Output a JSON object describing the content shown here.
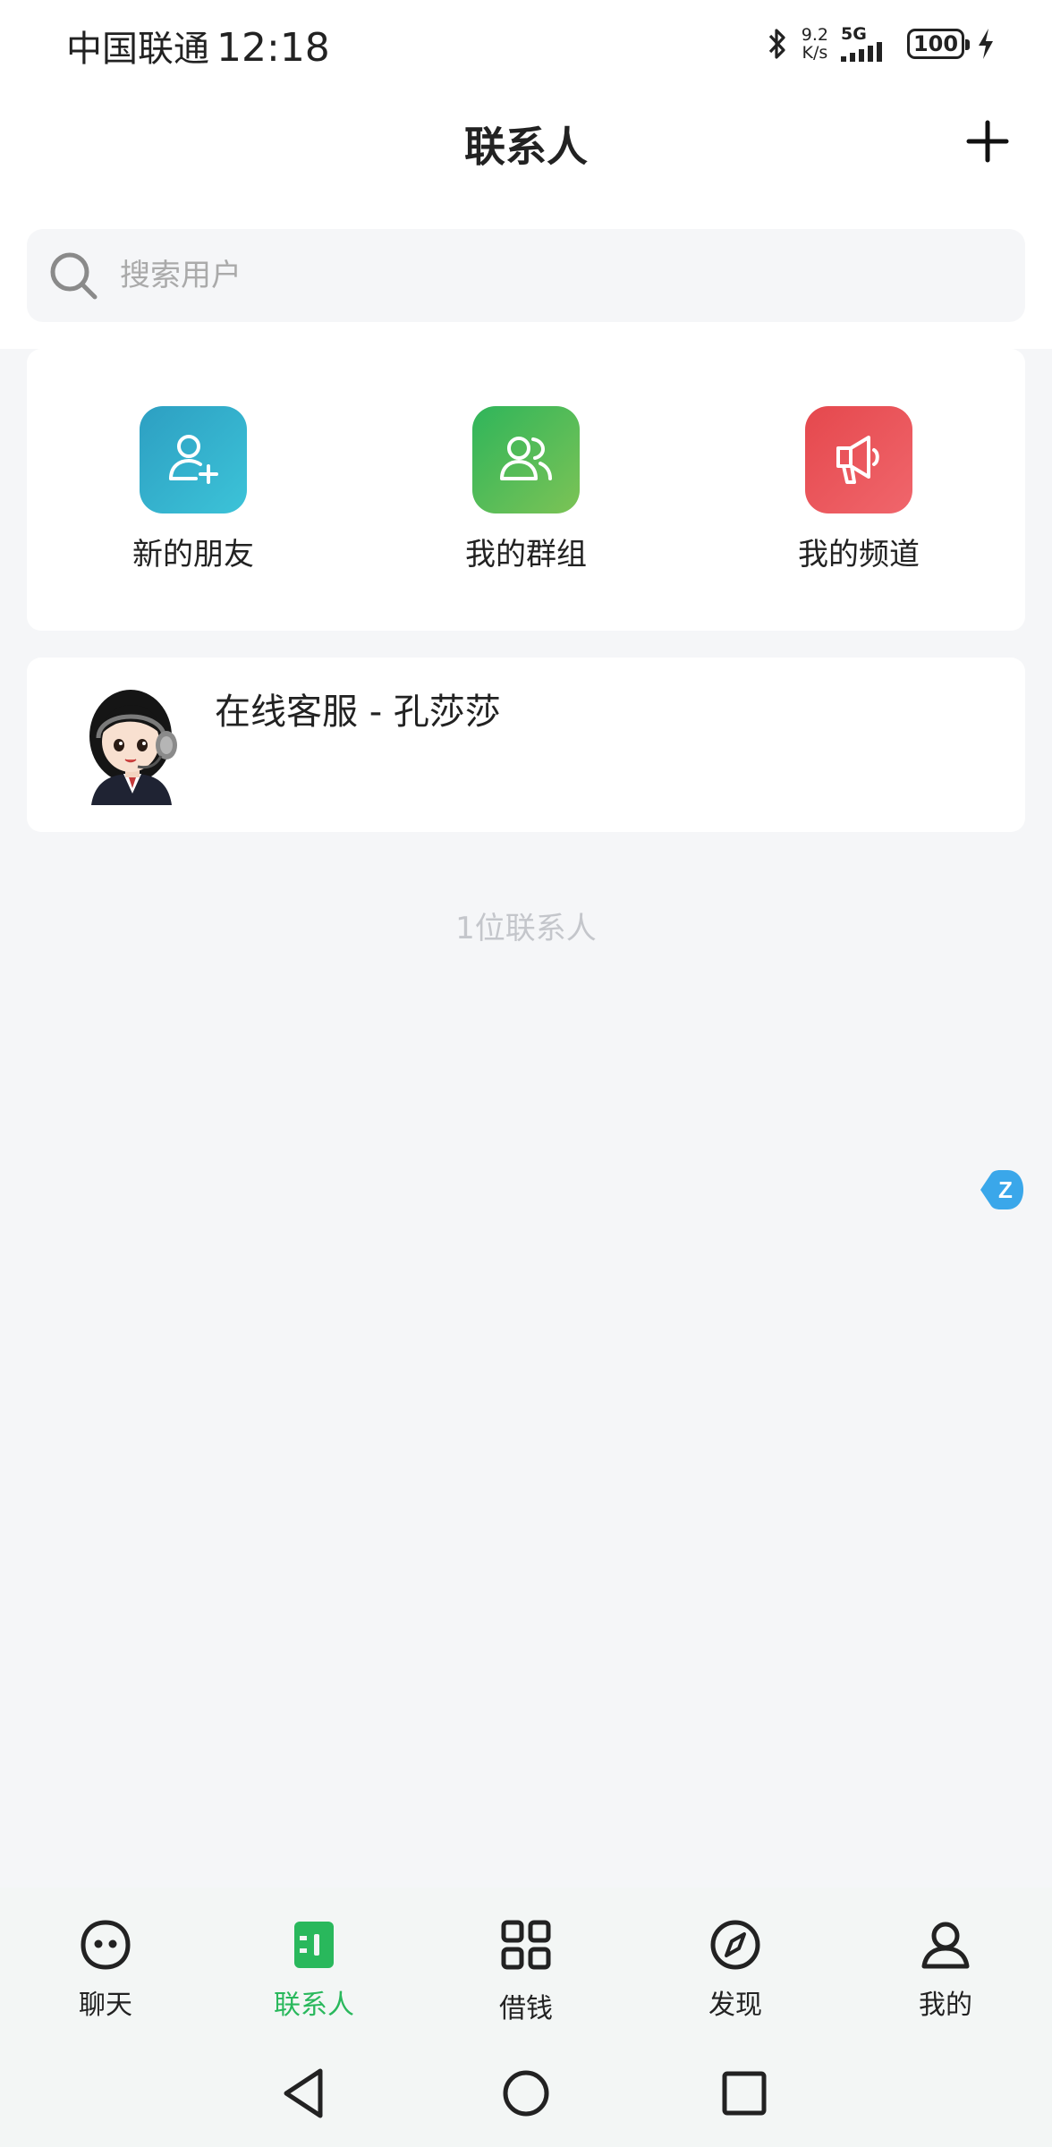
{
  "status_bar": {
    "carrier": "中国联通",
    "time": "12:18",
    "speed_value": "9.2",
    "speed_unit": "K/s",
    "network": "5G",
    "battery": "100"
  },
  "header": {
    "title": "联系人"
  },
  "search": {
    "placeholder": "搜索用户"
  },
  "quick_actions": [
    {
      "label": "新的朋友",
      "icon": "add-user-icon",
      "color_from": "#2d9fc2",
      "color_to": "#3cc3d8"
    },
    {
      "label": "我的群组",
      "icon": "group-icon",
      "color_from": "#2fb55a",
      "color_to": "#7cc356"
    },
    {
      "label": "我的频道",
      "icon": "megaphone-icon",
      "color_from": "#e5484d",
      "color_to": "#f0666c"
    }
  ],
  "contacts": [
    {
      "name": "在线客服 - 孔莎莎",
      "avatar": "customer-service-avatar"
    }
  ],
  "contact_count": "1位联系人",
  "float_badge": "Z",
  "bottom_nav": [
    {
      "label": "聊天",
      "icon": "chat-icon",
      "active": false
    },
    {
      "label": "联系人",
      "icon": "contacts-icon",
      "active": true
    },
    {
      "label": "借钱",
      "icon": "grid-icon",
      "active": false
    },
    {
      "label": "发现",
      "icon": "compass-icon",
      "active": false
    },
    {
      "label": "我的",
      "icon": "profile-icon",
      "active": false
    }
  ],
  "colors": {
    "accent": "#29b85c",
    "background": "#f5f6f8"
  }
}
